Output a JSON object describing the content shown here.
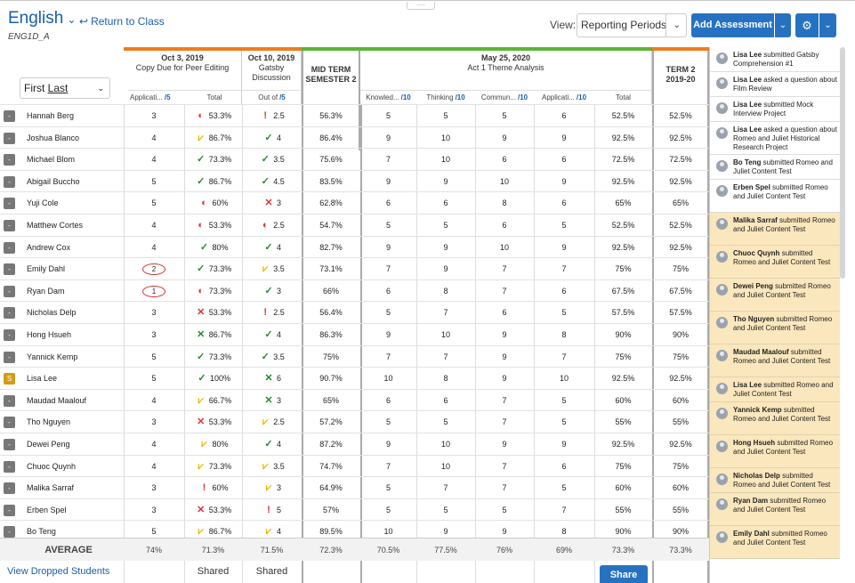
{
  "header": {
    "course_title": "English",
    "course_code": "ENG1D_A",
    "return_link": "Return to Class",
    "view_label": "View:",
    "view_value": "Reporting Periods",
    "add_assessment": "Add Assessment"
  },
  "sort_select": {
    "first": "First",
    "last": "Last"
  },
  "assessments": [
    {
      "date": "Oct 3, 2019",
      "title": "Copy Due for Peer Editing",
      "color": "#f07b1d"
    },
    {
      "date": "Oct 10, 2019",
      "title": "Gatsby Discussion",
      "color": "#f07b1d"
    },
    {
      "date": "May 25, 2020",
      "title": "Act 1 Theme Analysis",
      "color": "#5cb531"
    }
  ],
  "midterm": {
    "line1": "MID TERM",
    "line2": "SEMESTER 2",
    "color": "#5cb531"
  },
  "term": {
    "line1": "TERM 2",
    "line2": "2019-20",
    "color": "#f07b1d"
  },
  "subheaders": {
    "a1_app": "Applicati...",
    "a1_app_out": "/5",
    "a1_total": "Total",
    "a2_out_label": "Out of",
    "a2_out": "/5",
    "knowledge": "Knowled...",
    "knowledge_out": "/10",
    "thinking": "Thinking",
    "thinking_out": "/10",
    "communication": "Commun...",
    "communication_out": "/10",
    "application": "Applicati...",
    "application_out": "/10",
    "total": "Total"
  },
  "students": [
    {
      "badge": "-",
      "name": "Hannah Berg",
      "a1": "3",
      "a1_mark": "half",
      "a1_total": "53.3%",
      "a2_mark": "excl",
      "a2": "2.5",
      "mid": "56.3%",
      "k": "5",
      "t": "5",
      "c": "5",
      "a": "6",
      "total": "52.5%",
      "term": "52.5%"
    },
    {
      "badge": "-",
      "name": "Joshua Blanco",
      "a1": "4",
      "a1_mark": "partial",
      "a1_total": "86.7%",
      "a2_mark": "check",
      "a2": "4",
      "mid": "86.4%",
      "k": "9",
      "t": "10",
      "c": "9",
      "a": "9",
      "total": "92.5%",
      "term": "92.5%"
    },
    {
      "badge": "-",
      "name": "Michael Blom",
      "a1": "4",
      "a1_mark": "check",
      "a1_total": "73.3%",
      "a2_mark": "check",
      "a2": "3.5",
      "mid": "75.6%",
      "k": "7",
      "t": "10",
      "c": "6",
      "a": "6",
      "total": "72.5%",
      "term": "72.5%"
    },
    {
      "badge": "-",
      "name": "Abigail Buccho",
      "a1": "5",
      "a1_mark": "check",
      "a1_total": "86.7%",
      "a2_mark": "check",
      "a2": "4.5",
      "mid": "83.5%",
      "k": "9",
      "t": "9",
      "c": "10",
      "a": "9",
      "total": "92.5%",
      "term": "92.5%"
    },
    {
      "badge": "-",
      "name": "Yuji Cole",
      "a1": "5",
      "a1_mark": "half",
      "a1_total": "60%",
      "a2_mark": "x",
      "a2": "3",
      "mid": "62.8%",
      "k": "6",
      "t": "6",
      "c": "8",
      "a": "6",
      "total": "65%",
      "term": "65%"
    },
    {
      "badge": "-",
      "name": "Matthew Cortes",
      "a1": "4",
      "a1_mark": "half",
      "a1_total": "53.3%",
      "a2_mark": "half",
      "a2": "2.5",
      "mid": "54.7%",
      "k": "5",
      "t": "5",
      "c": "6",
      "a": "5",
      "total": "52.5%",
      "term": "52.5%"
    },
    {
      "badge": "-",
      "name": "Andrew Cox",
      "a1": "4",
      "a1_mark": "check",
      "a1_total": "80%",
      "a2_mark": "check",
      "a2": "4",
      "mid": "82.7%",
      "k": "9",
      "t": "9",
      "c": "10",
      "a": "9",
      "total": "92.5%",
      "term": "92.5%"
    },
    {
      "badge": "-",
      "name": "Emily Dahl",
      "a1": "2",
      "a1_circled": true,
      "a1_mark": "check",
      "a1_total": "73.3%",
      "a2_mark": "partial",
      "a2": "3.5",
      "mid": "73.1%",
      "k": "7",
      "t": "9",
      "c": "7",
      "a": "7",
      "total": "75%",
      "term": "75%"
    },
    {
      "badge": "-",
      "name": "Ryan Dam",
      "a1": "1",
      "a1_circled": true,
      "a1_mark": "half",
      "a1_total": "73.3%",
      "a2_mark": "check",
      "a2": "3",
      "mid": "66%",
      "k": "6",
      "t": "8",
      "c": "7",
      "a": "6",
      "total": "67.5%",
      "term": "67.5%"
    },
    {
      "badge": "-",
      "name": "Nicholas Delp",
      "a1": "3",
      "a1_mark": "x",
      "a1_total": "53.3%",
      "a2_mark": "excl",
      "a2": "2.5",
      "mid": "56.4%",
      "k": "5",
      "t": "7",
      "c": "6",
      "a": "5",
      "total": "57.5%",
      "term": "57.5%"
    },
    {
      "badge": "-",
      "name": "Hong Hsueh",
      "a1": "3",
      "a1_mark": "xgreen",
      "a1_total": "86.7%",
      "a2_mark": "check",
      "a2": "4",
      "mid": "86.3%",
      "k": "9",
      "t": "10",
      "c": "9",
      "a": "8",
      "total": "90%",
      "term": "90%"
    },
    {
      "badge": "-",
      "name": "Yannick Kemp",
      "a1": "5",
      "a1_mark": "check",
      "a1_total": "73.3%",
      "a2_mark": "check",
      "a2": "3.5",
      "mid": "75%",
      "k": "7",
      "t": "7",
      "c": "9",
      "a": "7",
      "total": "75%",
      "term": "75%"
    },
    {
      "badge": "S",
      "name": "Lisa Lee",
      "a1": "5",
      "a1_mark": "check",
      "a1_total": "100%",
      "a2_mark": "xgreen",
      "a2": "6",
      "mid": "90.7%",
      "k": "10",
      "t": "8",
      "c": "9",
      "a": "10",
      "total": "92.5%",
      "term": "92.5%"
    },
    {
      "badge": "-",
      "name": "Maudad Maalouf",
      "a1": "4",
      "a1_mark": "partial",
      "a1_total": "66.7%",
      "a2_mark": "xgreen",
      "a2": "3",
      "mid": "65%",
      "k": "6",
      "t": "6",
      "c": "7",
      "a": "5",
      "total": "60%",
      "term": "60%"
    },
    {
      "badge": "-",
      "name": "Tho Nguyen",
      "a1": "3",
      "a1_mark": "x",
      "a1_total": "53.3%",
      "a2_mark": "partial",
      "a2": "2.5",
      "mid": "57.2%",
      "k": "5",
      "t": "5",
      "c": "7",
      "a": "5",
      "total": "55%",
      "term": "55%"
    },
    {
      "badge": "-",
      "name": "Dewei Peng",
      "a1": "4",
      "a1_mark": "partial",
      "a1_total": "80%",
      "a2_mark": "check",
      "a2": "4",
      "mid": "87.2%",
      "k": "9",
      "t": "10",
      "c": "9",
      "a": "9",
      "total": "92.5%",
      "term": "92.5%"
    },
    {
      "badge": "-",
      "name": "Chuoc Quynh",
      "a1": "4",
      "a1_mark": "partial",
      "a1_total": "73.3%",
      "a2_mark": "partial",
      "a2": "3.5",
      "mid": "74.7%",
      "k": "7",
      "t": "10",
      "c": "7",
      "a": "6",
      "total": "75%",
      "term": "75%"
    },
    {
      "badge": "-",
      "name": "Malika Sarraf",
      "a1": "3",
      "a1_mark": "excl",
      "a1_total": "60%",
      "a2_mark": "partial",
      "a2": "3",
      "mid": "64.9%",
      "k": "5",
      "t": "7",
      "c": "7",
      "a": "5",
      "total": "60%",
      "term": "60%"
    },
    {
      "badge": "-",
      "name": "Erben Spel",
      "a1": "3",
      "a1_mark": "x",
      "a1_total": "53.3%",
      "a2_mark": "excl",
      "a2": "5",
      "mid": "57%",
      "k": "5",
      "t": "5",
      "c": "5",
      "a": "7",
      "total": "55%",
      "term": "55%"
    },
    {
      "badge": "-",
      "name": "Bo Teng",
      "a1": "5",
      "a1_mark": "partial",
      "a1_total": "86.7%",
      "a2_mark": "partial",
      "a2": "4",
      "mid": "89.5%",
      "k": "10",
      "t": "9",
      "c": "9",
      "a": "8",
      "total": "90%",
      "term": "90%"
    }
  ],
  "average": {
    "label": "AVERAGE",
    "a1": "74%",
    "a1_total": "71.3%",
    "a2": "71.5%",
    "mid": "72.3%",
    "k": "70.5%",
    "t": "77.5%",
    "c": "76%",
    "a": "69%",
    "total": "73.3%",
    "term": "73.3%"
  },
  "footer": {
    "dropped_link": "View Dropped Students",
    "shared1": "Shared",
    "shared2": "Shared",
    "share_button": "Share"
  },
  "feed": [
    {
      "who": "Lisa Lee",
      "text": "submitted Gatsby Comprehension #1",
      "hl": false
    },
    {
      "who": "Lisa Lee",
      "text": "asked a question about Film Review",
      "hl": false
    },
    {
      "who": "Lisa Lee",
      "text": "submitted Mock Interview Project",
      "hl": false
    },
    {
      "who": "Lisa Lee",
      "text": "asked a question about Romeo and Juliet Historical Research Project",
      "hl": false
    },
    {
      "who": "Bo Teng",
      "text": "submitted Romeo and Juliet Content Test",
      "hl": false
    },
    {
      "who": "Erben Spel",
      "text": "submitted Romeo and Juliet Content Test",
      "hl": false
    },
    {
      "who": "Malika Sarraf",
      "text": "submitted Romeo and Juliet Content Test",
      "hl": true
    },
    {
      "who": "Chuoc Quynh",
      "text": "submitted Romeo and Juliet Content Test",
      "hl": true
    },
    {
      "who": "Dewei Peng",
      "text": "submitted Romeo and Juliet Content Test",
      "hl": true
    },
    {
      "who": "Tho Nguyen",
      "text": "submitted Romeo and Juliet Content Test",
      "hl": true
    },
    {
      "who": "Maudad Maalouf",
      "text": "submitted Romeo and Juliet Content Test",
      "hl": true
    },
    {
      "who": "Lisa Lee",
      "text": "submitted Romeo and Juliet Content Test",
      "hl": true
    },
    {
      "who": "Yannick Kemp",
      "text": "submitted Romeo and Juliet Content Test",
      "hl": true
    },
    {
      "who": "Hong Hsueh",
      "text": "submitted Romeo and Juliet Content Test",
      "hl": true
    },
    {
      "who": "Nicholas Delp",
      "text": "submitted Romeo and Juliet Content Test",
      "hl": true
    },
    {
      "who": "Ryan Dam",
      "text": "submitted Romeo and Juliet Content Test",
      "hl": true
    },
    {
      "who": "Emily Dahl",
      "text": "submitted Romeo and Juliet Content Test",
      "hl": true
    }
  ],
  "icons": {
    "check": "✓",
    "x": "✕",
    "xgreen": "✕",
    "excl": "!",
    "half": "◐",
    "partial": "⩗"
  }
}
